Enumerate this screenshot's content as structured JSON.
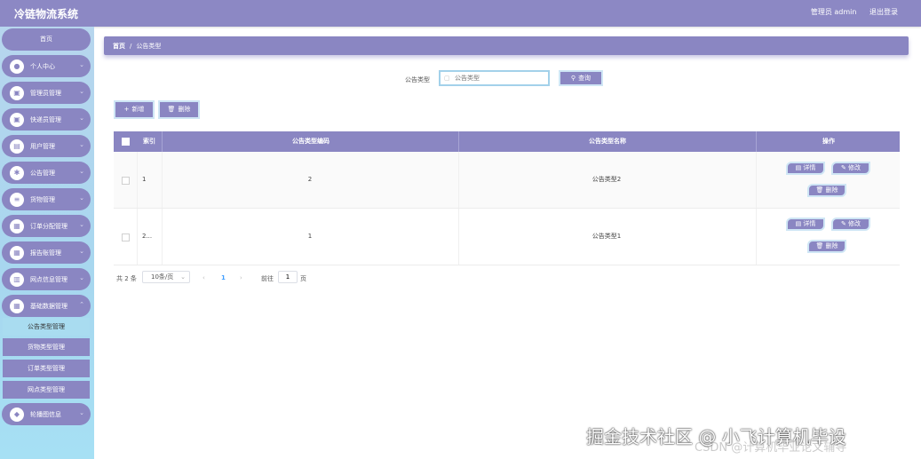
{
  "header": {
    "title": "冷链物流系统",
    "user_label": "管理员 admin",
    "logout_label": "退出登录"
  },
  "sidebar": {
    "home_label": "首页",
    "items": [
      {
        "label": "个人中心",
        "icon": "user-icon"
      },
      {
        "label": "管理员管理",
        "icon": "briefcase-icon"
      },
      {
        "label": "快递员管理",
        "icon": "briefcase-icon"
      },
      {
        "label": "用户管理",
        "icon": "id-card-icon"
      },
      {
        "label": "公告管理",
        "icon": "settings-icon"
      },
      {
        "label": "货物管理",
        "icon": "sliders-icon"
      },
      {
        "label": "订单分配管理",
        "icon": "grid-icon"
      },
      {
        "label": "报告账管理",
        "icon": "grid-icon"
      },
      {
        "label": "网点信息管理",
        "icon": "bar-chart-icon"
      },
      {
        "label": "基础数据管理",
        "icon": "grid-icon"
      }
    ],
    "sub_items": [
      {
        "label": "公告类型管理",
        "active": true
      },
      {
        "label": "货物类型管理",
        "active": false
      },
      {
        "label": "订单类型管理",
        "active": false
      },
      {
        "label": "网点类型管理",
        "active": false
      }
    ],
    "last_item": {
      "label": "轮播图信息",
      "icon": "shield-icon"
    }
  },
  "breadcrumb": {
    "home": "首页",
    "separator": "/",
    "current": "公告类型"
  },
  "search": {
    "label": "公告类型",
    "placeholder": "公告类型",
    "button_label": "查询"
  },
  "toolbar": {
    "add_label": "新增",
    "delete_label": "删除"
  },
  "table": {
    "headers": {
      "index": "索引",
      "code": "公告类型编码",
      "name": "公告类型名称",
      "actions": "操作"
    },
    "rows": [
      {
        "index": "1",
        "code": "2",
        "name": "公告类型2"
      },
      {
        "index": "2...",
        "code": "1",
        "name": "公告类型1"
      }
    ],
    "row_actions": {
      "detail": "详情",
      "edit": "修改",
      "delete": "删除"
    }
  },
  "pagination": {
    "total": "共 2 条",
    "page_size": "10条/页",
    "current_page": "1",
    "goto_label": "前往",
    "goto_value": "1",
    "page_unit": "页"
  },
  "watermark": {
    "main": "掘金技术社区 @ 小飞计算机毕设",
    "sub": "CSDN @计算机毕业论文辅导"
  },
  "colors": {
    "primary": "#8a86c2",
    "sidebar_bg": "#a7d7ef",
    "active_sub": "#a9dcf0",
    "page_accent": "#409eff"
  }
}
